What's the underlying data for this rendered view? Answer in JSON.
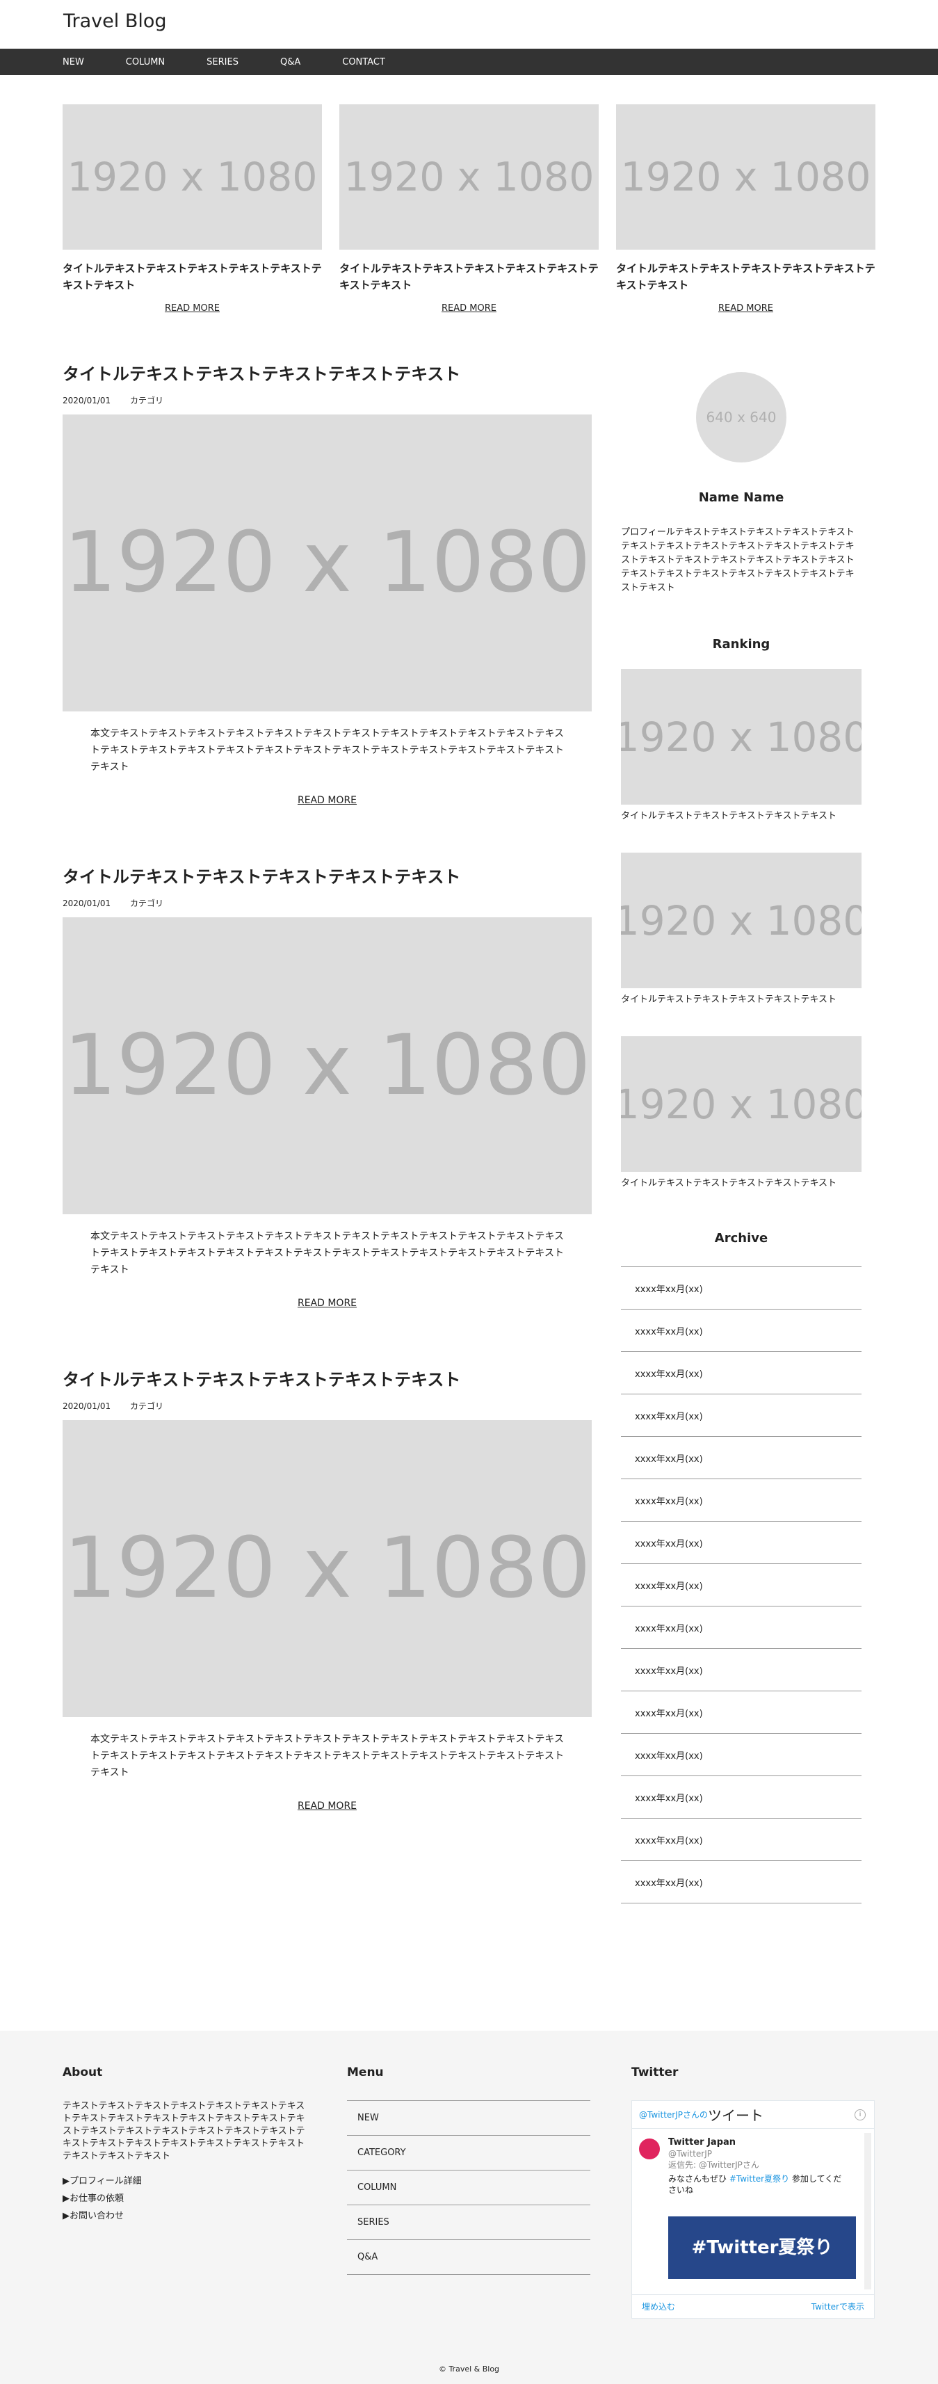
{
  "header": {
    "title": "Travel Blog"
  },
  "nav": [
    "NEW",
    "COLUMN",
    "SERIES",
    "Q&A",
    "CONTACT"
  ],
  "placeholder": {
    "wide": "1920 x 1080",
    "square": "640 x 640"
  },
  "pickup": [
    {
      "title": "タイトルテキストテキストテキストテキストテキストテキストテキスト",
      "link": "READ MORE"
    },
    {
      "title": "タイトルテキストテキストテキストテキストテキストテキストテキスト",
      "link": "READ MORE"
    },
    {
      "title": "タイトルテキストテキストテキストテキストテキストテキストテキスト",
      "link": "READ MORE"
    }
  ],
  "posts": [
    {
      "title": "タイトルテキストテキストテキストテキストテキスト",
      "date": "2020/01/01",
      "category": "カテゴリ",
      "body": "本文テキストテキストテキストテキストテキストテキストテキストテキストテキストテキストテキストテキストテキストテキストテキストテキストテキストテキストテキストテキストテキストテキストテキストテキストテキスト",
      "link": "READ MORE"
    },
    {
      "title": "タイトルテキストテキストテキストテキストテキスト",
      "date": "2020/01/01",
      "category": "カテゴリ",
      "body": "本文テキストテキストテキストテキストテキストテキストテキストテキストテキストテキストテキストテキストテキストテキストテキストテキストテキストテキストテキストテキストテキストテキストテキストテキストテキスト",
      "link": "READ MORE"
    },
    {
      "title": "タイトルテキストテキストテキストテキストテキスト",
      "date": "2020/01/01",
      "category": "カテゴリ",
      "body": "本文テキストテキストテキストテキストテキストテキストテキストテキストテキストテキストテキストテキストテキストテキストテキストテキストテキストテキストテキストテキストテキストテキストテキストテキストテキスト",
      "link": "READ MORE"
    }
  ],
  "sidebar": {
    "name": "Name Name",
    "profile": "プロフィールテキストテキストテキストテキストテキストテキストテキストテキストテキストテキストテキストテキストテキストテキストテキストテキストテキストテキストテキストテキストテキストテキストテキストテキストテキストテキスト",
    "ranking_title": "Ranking",
    "ranking": [
      "タイトルテキストテキストテキストテキストテキスト",
      "タイトルテキストテキストテキストテキストテキスト",
      "タイトルテキストテキストテキストテキストテキスト"
    ],
    "archive_title": "Archive",
    "archive": [
      "xxxx年xx月(xx)",
      "xxxx年xx月(xx)",
      "xxxx年xx月(xx)",
      "xxxx年xx月(xx)",
      "xxxx年xx月(xx)",
      "xxxx年xx月(xx)",
      "xxxx年xx月(xx)",
      "xxxx年xx月(xx)",
      "xxxx年xx月(xx)",
      "xxxx年xx月(xx)",
      "xxxx年xx月(xx)",
      "xxxx年xx月(xx)",
      "xxxx年xx月(xx)",
      "xxxx年xx月(xx)",
      "xxxx年xx月(xx)"
    ]
  },
  "footer": {
    "about_title": "About",
    "about_text": "テキストテキストテキストテキストテキストテキストテキストテキストテキストテキストテキストテキストテキストテキストテキストテキストテキストテキストテキストテキストテキストテキストテキストテキストテキストテキストテキストテキストテキストテキスト",
    "links": [
      "プロフィール詳細",
      "お仕事の依頼",
      "お問い合わせ"
    ],
    "menu_title": "Menu",
    "menu": [
      "NEW",
      "CATEGORY",
      "COLUMN",
      "SERIES",
      "Q&A"
    ],
    "twitter_title": "Twitter",
    "copyright": "© Travel & Blog"
  },
  "twitter": {
    "head_prefix": "@TwitterJPさんの",
    "head_main": "ツイート",
    "info": "i",
    "name": "Twitter Japan",
    "handle": "@TwitterJP",
    "retweet": "返信先: @TwitterJPさん",
    "text_pre": "みなさんもぜひ ",
    "hashtag": "#Twitter夏祭り",
    "text_post": " 参加してくださいね",
    "image_text": "#Twitter夏祭り",
    "embed": "埋め込む",
    "view": "Twitterで表示"
  },
  "colors": {
    "nav_bg": "#333333",
    "placeholder": "#dddddd",
    "footer_bg": "#f5f5f5",
    "twitter_blue": "#1b95e0"
  }
}
